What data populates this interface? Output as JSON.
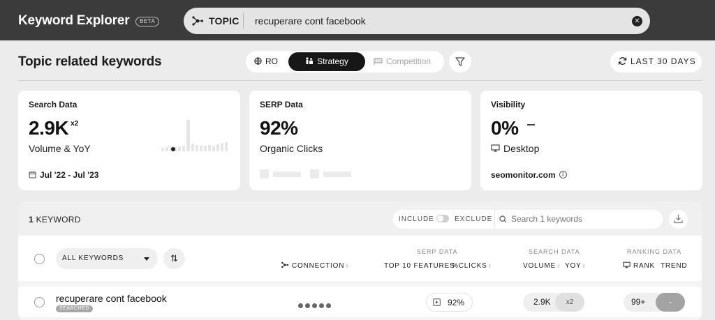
{
  "header": {
    "app_title": "Keyword Explorer",
    "beta_label": "BETA",
    "topic_label": "TOPIC",
    "query": "recuperare cont facebook",
    "clear_icon": "close-icon"
  },
  "toolbar": {
    "title": "Topic related keywords",
    "locale": "RO",
    "mode_active": "Strategy",
    "mode_inactive": "Competition",
    "date_range": "LAST 30 DAYS"
  },
  "cards": {
    "search": {
      "title": "Search Data",
      "value": "2.9K",
      "yoy": "x2",
      "subtitle": "Volume & YoY",
      "period": "Jul '22 - Jul '23"
    },
    "serp": {
      "title": "SERP Data",
      "value": "92%",
      "subtitle": "Organic Clicks"
    },
    "visibility": {
      "title": "Visibility",
      "value": "0%",
      "subtitle": "Desktop",
      "domain": "seomonitor.com"
    }
  },
  "table": {
    "count_number": "1",
    "count_label": "KEYWORD",
    "include_label": "INCLUDE",
    "exclude_label": "EXCLUDE",
    "search_placeholder": "Search 1 keywords",
    "filter_select": "ALL KEYWORDS",
    "groups": {
      "serp": "SERP DATA",
      "search": "SEARCH DATA",
      "ranking": "RANKING DATA"
    },
    "columns": {
      "connection": "CONNECTION",
      "top10": "TOP 10 FEATURES",
      "clicks": "%CLICKS",
      "volume": "VOLUME",
      "yoy": "YOY",
      "rank": "RANK",
      "trend": "TREND"
    },
    "rows": [
      {
        "keyword": "recuperare cont facebook",
        "badge": "SEARCHED",
        "clicks": "92%",
        "volume": "2.9K",
        "yoy": "x2",
        "rank": "99+",
        "trend": "-"
      }
    ]
  },
  "colors": {
    "topbar": "#3b3b3b",
    "active_segment": "#171717",
    "background": "#ececec"
  }
}
